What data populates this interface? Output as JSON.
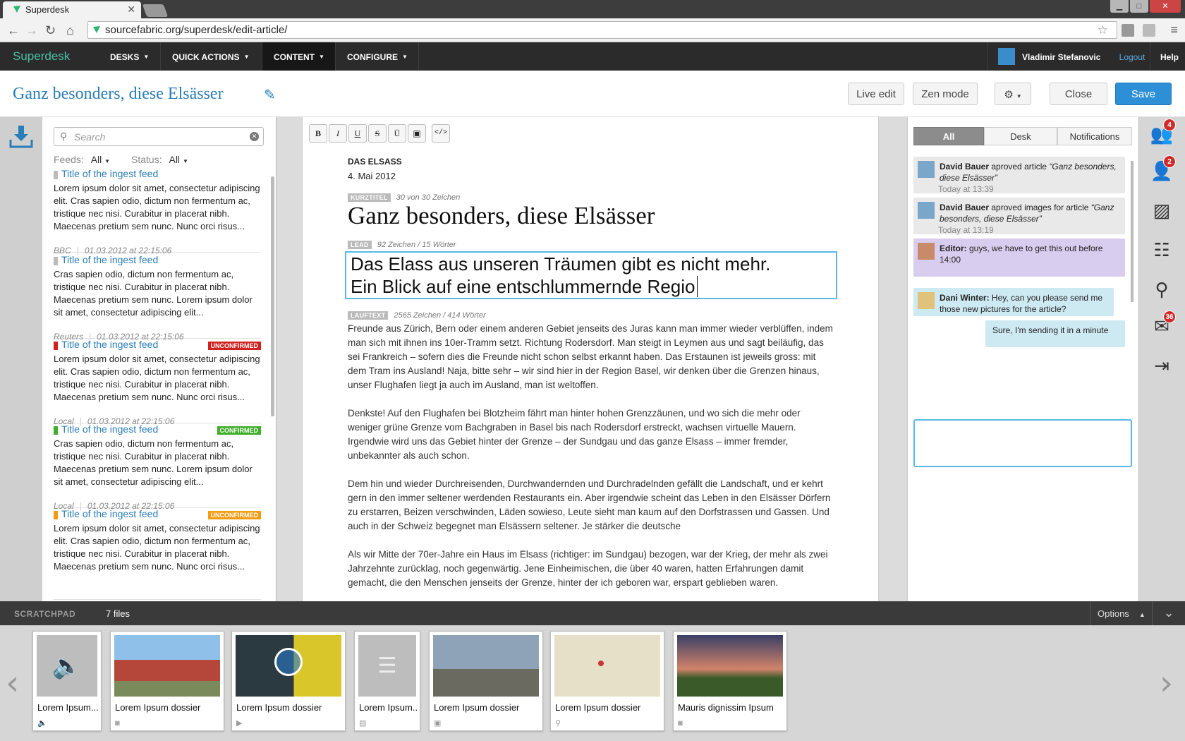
{
  "browser": {
    "tab_title": "Superdesk",
    "tab_close": "✕",
    "url": "sourcefabric.org/superdesk/edit-article/"
  },
  "nav": {
    "logo": "Superdesk",
    "items": [
      "DESKS",
      "QUICK ACTIONS",
      "CONTENT",
      "CONFIGURE"
    ],
    "active": "CONTENT",
    "user_name": "Vladimir Stefanovic",
    "logout": "Logout",
    "help": "Help"
  },
  "title_bar": {
    "title": "Ganz besonders, diese Elsässer",
    "live_edit": "Live edit",
    "zen_mode": "Zen mode",
    "close": "Close",
    "save": "Save"
  },
  "ingest": {
    "search_placeholder": "Search",
    "feeds_label": "Feeds:",
    "feeds_value": "All",
    "status_label": "Status:",
    "status_value": "All",
    "items": [
      {
        "title": "Title of the ingest feed",
        "color": "#bbbbbb",
        "badge": "",
        "body": "Lorem ipsum dolor sit amet, consectetur adipiscing elit. Cras sapien odio, dictum non fermentum ac, tristique nec nisi. Curabitur in placerat nibh. Maecenas pretium sem nunc. Nunc orci risus...",
        "source": "BBC",
        "date": "01.03.2012 at 22:15:06"
      },
      {
        "title": "Title of the ingest feed",
        "color": "#bbbbbb",
        "badge": "",
        "body": "Cras sapien odio, dictum non fermentum ac, tristique nec nisi. Curabitur in placerat nibh. Maecenas pretium sem nunc. Lorem ipsum dolor sit amet, consectetur adipiscing elit...",
        "source": "Reuters",
        "date": "01.03.2012 at 22:15:06"
      },
      {
        "title": "Title of the ingest feed",
        "color": "#d02020",
        "badge": "UNCONFIRMED",
        "badge_color": "#d02020",
        "body": "Lorem ipsum dolor sit amet, consectetur adipiscing elit. Cras sapien odio, dictum non fermentum ac, tristique nec nisi. Curabitur in placerat nibh. Maecenas pretium sem nunc. Nunc orci risus...",
        "source": "Local",
        "date": "01.03.2012 at 22:15:06"
      },
      {
        "title": "Title of the ingest feed",
        "color": "#3fae2a",
        "badge": "CONFIRMED",
        "badge_color": "#3fae2a",
        "body": "Cras sapien odio, dictum non fermentum ac, tristique nec nisi. Curabitur in placerat nibh. Maecenas pretium sem nunc. Lorem ipsum dolor sit amet, consectetur adipiscing elit...",
        "source": "Local",
        "date": "01.03.2012 at 22:15:06"
      },
      {
        "title": "Title of the ingest feed",
        "color": "#f39c12",
        "badge": "UNCONFIRMED",
        "badge_color": "#f39c12",
        "body": "Lorem ipsum dolor sit amet, consectetur adipiscing elit. Cras sapien odio, dictum non fermentum ac, tristique nec nisi. Curabitur in placerat nibh. Maecenas pretium sem nunc. Nunc orci risus...",
        "source": "",
        "date": ""
      }
    ]
  },
  "editor": {
    "toolbar": [
      "B",
      "I",
      "U",
      "S",
      "Ü",
      "▣",
      "</>"
    ],
    "section": "DAS ELSASS",
    "date": "4. Mai 2012",
    "kurz_tag": "KURZTITEL",
    "kurz_info": "30 von 30 Zeichen",
    "headline": "Ganz besonders, diese Elsässer",
    "lead_tag": "LEAD",
    "lead_info": "92 Zeichen / 15 Wörter",
    "lead_line1": "Das Elass aus unseren Träumen gibt es nicht mehr.",
    "lead_line2": "Ein Blick auf eine entschlummernde Regio",
    "lauf_tag": "LAUFTEXT",
    "lauf_info": "2565 Zeichen / 414 Wörter",
    "paragraphs": [
      "Freunde aus Zürich, Bern oder einem anderen Gebiet jenseits des Juras kann man immer wieder verblüffen, indem man sich mit ihnen ins 10er-Tramm setzt. Richtung Rodersdorf. Man steigt in Leymen aus und sagt beiläufig, das sei Frankreich – sofern dies die Freunde nicht schon selbst erkannt haben. Das Erstaunen ist jeweils gross: mit dem Tram ins Ausland! Naja, bitte sehr – wir sind hier in der Region Basel, wir denken über die Grenzen hinaus, unser Flughafen liegt ja auch im Ausland, man ist weltoffen.",
      "Denkste! Auf den Flughafen bei Blotzheim fährt man hinter hohen Grenzzäunen, und wo sich die mehr oder weniger grüne Grenze vom Bachgraben in Basel bis nach Rodersdorf erstreckt, wachsen virtuelle Mauern. Irgendwie wird uns das Gebiet hinter der Grenze – der Sundgau und das ganze Elsass – immer fremder, unbekannter als auch schon.",
      "Dem hin und wieder Durchreisenden, Durchwandernden und Durchradelnden gefällt die Landschaft, und er kehrt gern in den immer seltener werdenden Restaurants ein. Aber irgendwie scheint das Leben in den Elsässer Dörfern zu erstarren, Beizen verschwinden, Läden sowieso, Leute sieht man kaum auf den Dorfstrassen und Gassen. Und auch in der Schweiz begegnet man Elsässern seltener. Je stärker die deutsche",
      "Als wir Mitte der 70er-Jahre ein Haus im Elsass (richtiger: im Sundgau) bezogen, war der Krieg, der mehr als zwei Jahrzehnte zurücklag, noch gegenwärtig. Jene Einheimischen, die über 40 waren, hatten Erfahrungen damit gemacht, die den Menschen jenseits der Grenze, hinter der ich geboren war, erspart geblieben waren."
    ]
  },
  "activity": {
    "tabs": [
      "All",
      "Desk",
      "Notifications"
    ],
    "messages": [
      {
        "author": "David Bauer",
        "text": " aproved article ",
        "quote": "“Ganz besonders, diese Elsässer”",
        "time": "Today at 13:39"
      },
      {
        "author": "David Bauer",
        "text": " aproved images for article ",
        "quote": "“Ganz besonders, diese Elsässer”",
        "time": "Today at 13:19"
      },
      {
        "author": "Editor:",
        "text": " guys, we have to get this out before 14:00",
        "quote": "",
        "time": ""
      },
      {
        "author": "Dani Winter:",
        "text": " Hey, can you please send me those new pictures for the article?",
        "quote": "",
        "time": ""
      },
      {
        "author": "",
        "text": "Sure, I'm sending it in a minute",
        "quote": "",
        "time": ""
      }
    ]
  },
  "sidebar_icons": [
    {
      "name": "users-icon",
      "badge": "4"
    },
    {
      "name": "desk-user-icon",
      "badge": "2"
    },
    {
      "name": "image-icon",
      "badge": ""
    },
    {
      "name": "sliders-icon",
      "badge": ""
    },
    {
      "name": "map-pin-icon",
      "badge": ""
    },
    {
      "name": "comments-icon",
      "badge": "36"
    },
    {
      "name": "export-icon",
      "badge": ""
    }
  ],
  "scratchpad": {
    "label": "SCRATCHPAD",
    "count": "7 files",
    "options": "Options",
    "items": [
      {
        "label": "Lorem Ipsum...",
        "type": "audio"
      },
      {
        "label": "Lorem Ipsum dossier",
        "type": "photo"
      },
      {
        "label": "Lorem Ipsum dossier",
        "type": "video"
      },
      {
        "label": "Lorem Ipsum...",
        "type": "text"
      },
      {
        "label": "Lorem Ipsum dossier",
        "type": "gallery"
      },
      {
        "label": "Lorem Ipsum dossier",
        "type": "map"
      },
      {
        "label": "Mauris dignissim Ipsum",
        "type": "photo"
      }
    ]
  }
}
